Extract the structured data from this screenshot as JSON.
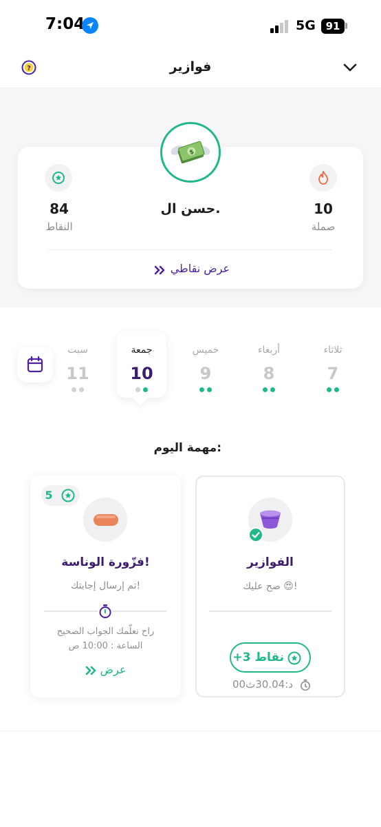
{
  "status": {
    "time": "7:04",
    "network": "5G",
    "battery": "91"
  },
  "header": {
    "title": "فوازير"
  },
  "profile": {
    "name": "حسن ال.",
    "points_value": "84",
    "points_label": "النقاط",
    "streak_value": "10",
    "streak_label": "صملة",
    "view_points": "عرض نقاطي"
  },
  "days": [
    {
      "name": "سبت",
      "number": "11",
      "dots": 2,
      "state": "future"
    },
    {
      "name": "جمعة",
      "number": "10",
      "dots": 2,
      "state": "today"
    },
    {
      "name": "خميس",
      "number": "9",
      "dots": 2,
      "state": "done"
    },
    {
      "name": "أربعاء",
      "number": "8",
      "dots": 2,
      "state": "done"
    },
    {
      "name": "ثلاثاء",
      "number": "7",
      "dots": 2,
      "state": "done"
    }
  ],
  "task_section_title": "مهمة اليوم:",
  "tasks": {
    "riddle": {
      "title": "فزّورة الوناسة!",
      "subtitle": "تم إرسال إجابتك!",
      "reveal_line1": "راح نعلّمك الجواب الصحيح",
      "reveal_line2": "الساعة : 10:00 ص",
      "view_label": "عرض",
      "reward": "5"
    },
    "fawazeer": {
      "title": "الفوازير",
      "subtitle": "صح عليك 😍!",
      "points_pill": "+3 نقاط",
      "countdown": "00د:30.04ث"
    }
  },
  "colors": {
    "brand_green": "#1fb88a",
    "brand_purple": "#4b1fa0",
    "streak_orange": "#f26b3a"
  },
  "icons": [
    "help-icon",
    "chevron-down-icon",
    "star-badge-icon",
    "flame-icon",
    "calendar-icon",
    "stopwatch-icon",
    "check-icon",
    "double-chevron-icon",
    "money-icon"
  ]
}
